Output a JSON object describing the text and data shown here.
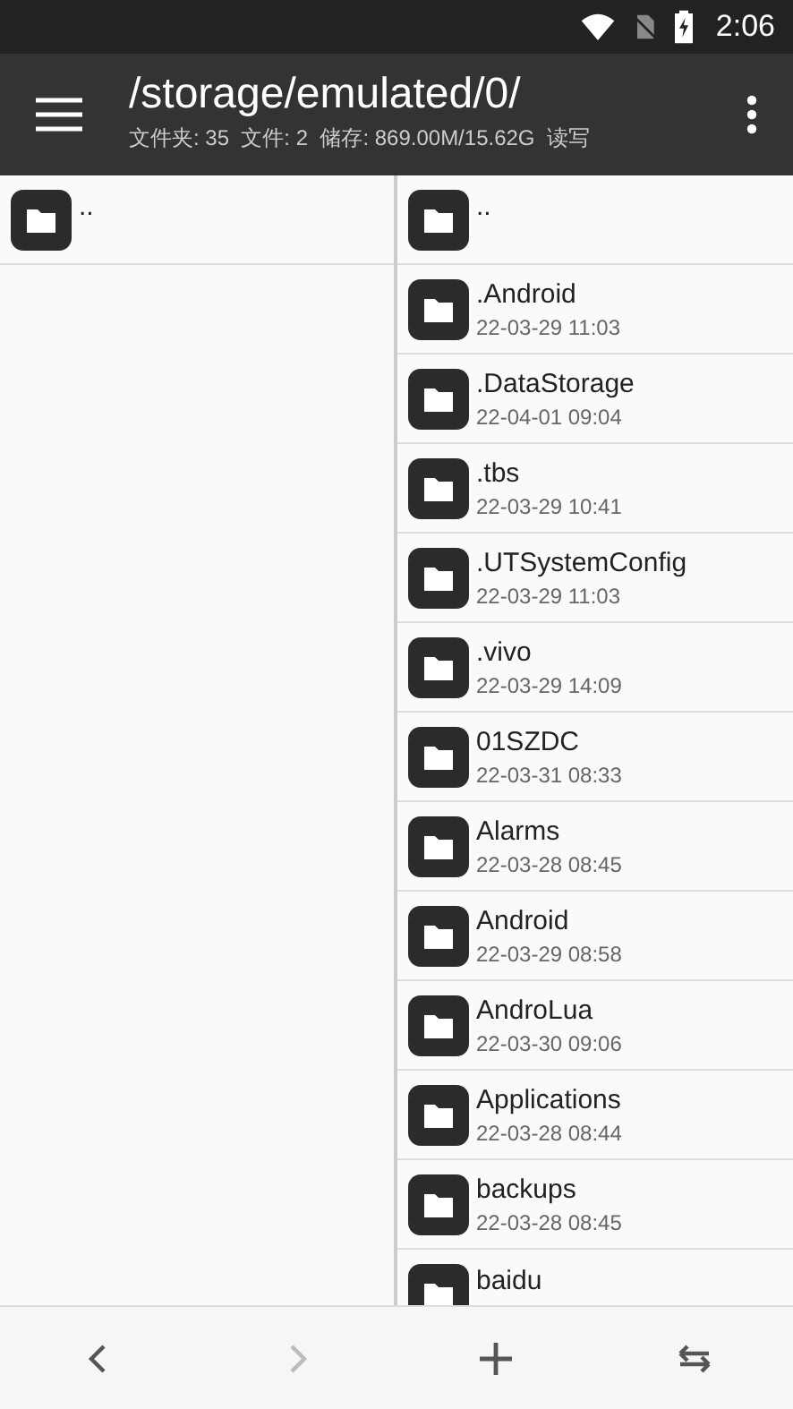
{
  "status_bar": {
    "time": "2:06"
  },
  "toolbar": {
    "title": "/storage/emulated/0/",
    "subtitle": "文件夹: 35  文件: 2  储存: 869.00M/15.62G  读写"
  },
  "left_pane": {
    "items": [
      {
        "name": ".."
      }
    ]
  },
  "right_pane": {
    "items": [
      {
        "name": ".."
      },
      {
        "name": ".Android",
        "date": "22-03-29 11:03"
      },
      {
        "name": ".DataStorage",
        "date": "22-04-01 09:04"
      },
      {
        "name": ".tbs",
        "date": "22-03-29 10:41"
      },
      {
        "name": ".UTSystemConfig",
        "date": "22-03-29 11:03"
      },
      {
        "name": ".vivo",
        "date": "22-03-29 14:09"
      },
      {
        "name": "01SZDC",
        "date": "22-03-31 08:33"
      },
      {
        "name": "Alarms",
        "date": "22-03-28 08:45"
      },
      {
        "name": "Android",
        "date": "22-03-29 08:58"
      },
      {
        "name": "AndroLua",
        "date": "22-03-30 09:06"
      },
      {
        "name": "Applications",
        "date": "22-03-28 08:44"
      },
      {
        "name": "backups",
        "date": "22-03-28 08:45"
      },
      {
        "name": "baidu"
      }
    ]
  },
  "bottom_bar": {
    "buttons": [
      {
        "kind": "back",
        "disabled": false
      },
      {
        "kind": "forward",
        "disabled": true
      },
      {
        "kind": "add",
        "disabled": false
      },
      {
        "kind": "swap",
        "disabled": false
      }
    ]
  }
}
